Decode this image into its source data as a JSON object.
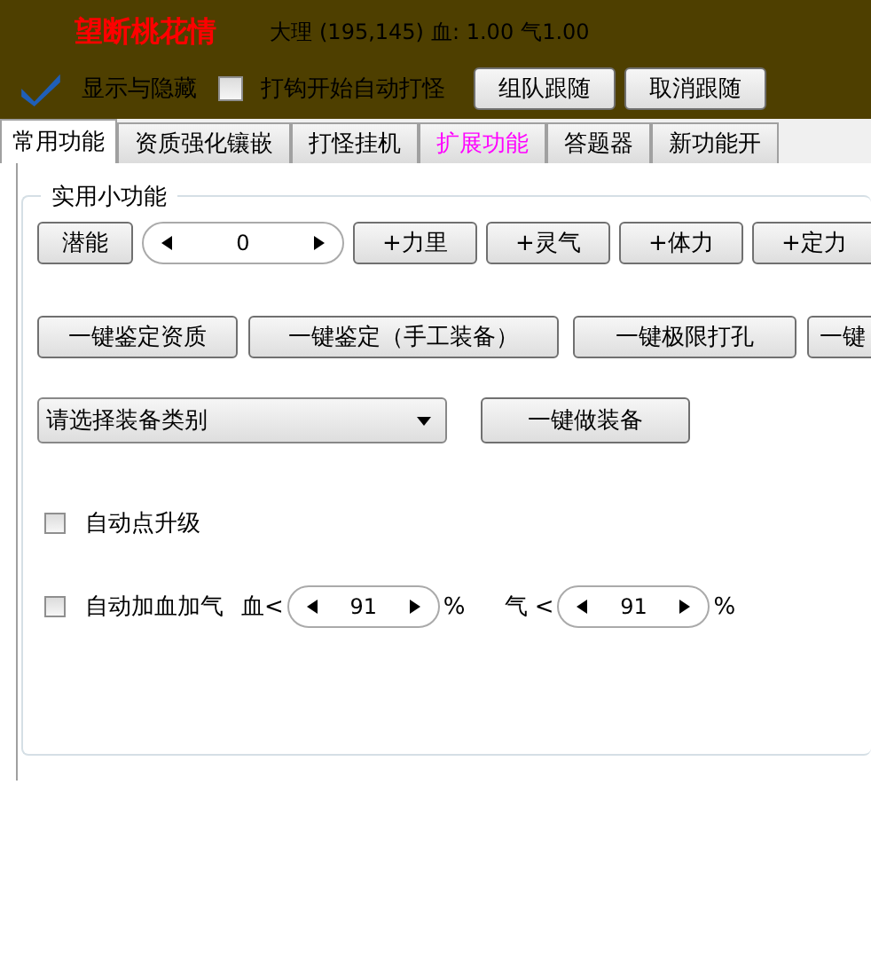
{
  "header": {
    "title": "望断桃花情",
    "map": "大理",
    "coords": "(195,145)",
    "hp": "血: 1.00",
    "mp": "气1.00",
    "show_toggle": {
      "label": "显示与隐藏",
      "checked": true
    },
    "auto_fight": {
      "label": "打钩开始自动打怪",
      "checked": false
    },
    "buttons": [
      "组队跟随",
      "取消跟随"
    ]
  },
  "tabs": [
    {
      "label": "常用功能",
      "selected": true,
      "color": "#000000"
    },
    {
      "label": "资质强化镶嵌",
      "selected": false,
      "color": "#000000"
    },
    {
      "label": "打怪挂机",
      "selected": false,
      "color": "#000000"
    },
    {
      "label": "扩展功能",
      "selected": false,
      "color": "#ff00ff"
    },
    {
      "label": "答题器",
      "selected": false,
      "color": "#000000"
    },
    {
      "label": "新功能开",
      "selected": false,
      "color": "#000000"
    }
  ],
  "group": {
    "title": "实用小功能",
    "potential_button": "潜能",
    "potential_value": "0",
    "stat_buttons": [
      "+力里",
      "+灵气",
      "+体力",
      "+定力"
    ],
    "identify_buttons": [
      "一键鉴定资质",
      "一键鉴定（手工装备）",
      "一键极限打孔",
      "一键"
    ],
    "equip_select": {
      "value": "请选择装备类别"
    },
    "make_button": "一键做装备",
    "auto_level": {
      "label": "自动点升级",
      "checked": false
    },
    "auto_heal": {
      "label": "自动加血加气",
      "checked": false,
      "hp_label": "血<",
      "hp_value": "91",
      "hp_unit": "%",
      "mp_label": "气 <",
      "mp_value": "91",
      "mp_unit": "%"
    }
  }
}
